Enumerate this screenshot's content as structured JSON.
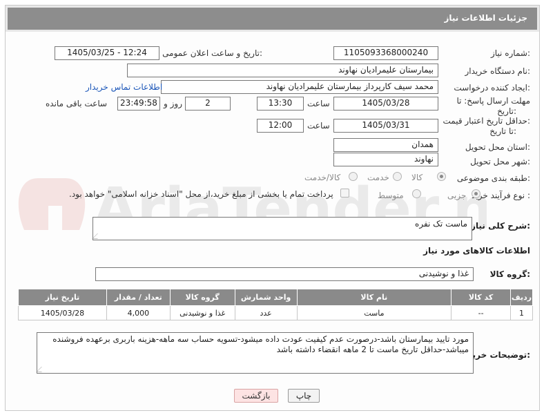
{
  "title": "جزئیات اطلاعات نیاز",
  "fields": {
    "need_number_label": "شماره نیاز:",
    "need_number": "1105093368000240",
    "announce_label": "تاریخ و ساعت اعلان عمومی:",
    "announce_value": "1405/03/25 - 12:24",
    "buyer_org_label": "نام دستگاه خریدار:",
    "buyer_org": "بیمارستان علیمرادیان نهاوند",
    "creator_label": "ایجاد کننده درخواست:",
    "creator": "محمد سیف کارپرداز بیمارستان علیمرادیان نهاوند",
    "buyer_contact_link": "اطلاعات تماس خریدار",
    "deadline_label_line1": "مهلت ارسال پاسخ: تا",
    "deadline_label_line2": "تاریخ:",
    "deadline_date": "1405/03/28",
    "time_label": "ساعت",
    "deadline_time": "13:30",
    "days_value": "2",
    "days_label": "روز و",
    "remaining_time": "23:49:58",
    "remaining_label": "ساعت باقی مانده",
    "price_validity_label_line1": "حداقل تاریخ اعتبار قیمت:",
    "price_validity_label_line2": "تا تاریخ:",
    "price_validity_date": "1405/03/31",
    "price_validity_time": "12:00",
    "province_label": "استان محل تحویل:",
    "province": "همدان",
    "city_label": "شهر محل تحویل:",
    "city": "نهاوند",
    "category_label": "طبقه بندی موضوعی:",
    "category_options": [
      "کالا",
      "خدمت",
      "کالا/خدمت"
    ],
    "process_label": "نوع فرآیند خرید :",
    "process_options": [
      "جزیی",
      "متوسط"
    ],
    "payment_note": "پرداخت تمام یا بخشی از مبلغ خرید،از محل \"اسناد خزانه اسلامی\" خواهد بود."
  },
  "description": {
    "label": "شرح کلی نیاز:",
    "value": "ماست تک نفره"
  },
  "goods_section": {
    "title": "اطلاعات کالاهای مورد نیاز",
    "group_label": "گروه کالا:",
    "group_value": "غذا و نوشیدنی"
  },
  "table": {
    "headers": [
      "ردیف",
      "کد کالا",
      "نام کالا",
      "واحد شمارش",
      "گروه کالا",
      "تعداد / مقدار",
      "تاریخ نیاز"
    ],
    "rows": [
      [
        "1",
        "--",
        "ماست",
        "عدد",
        "غذا و نوشیدنی",
        "4,000",
        "1405/03/28"
      ]
    ]
  },
  "buyer_notes": {
    "label": "توضیحات خریدار:",
    "value": "مورد تایید بیمارستان باشد-درصورت عدم کیفیت عودت داده میشود-تسویه حساب سه ماهه-هزینه باربری برعهده فروشنده میباشد-حداقل تاریخ ماست تا 2 ماهه انقضاء داشته باشد"
  },
  "buttons": {
    "print": "چاپ",
    "back": "بازگشت"
  },
  "watermark_text": "AriaTender.neT",
  "colors": {
    "title_bar": "#8d8d8d",
    "table_header": "#8a8a8a",
    "link": "#1a55b8",
    "back_button": "#fde3e3"
  }
}
